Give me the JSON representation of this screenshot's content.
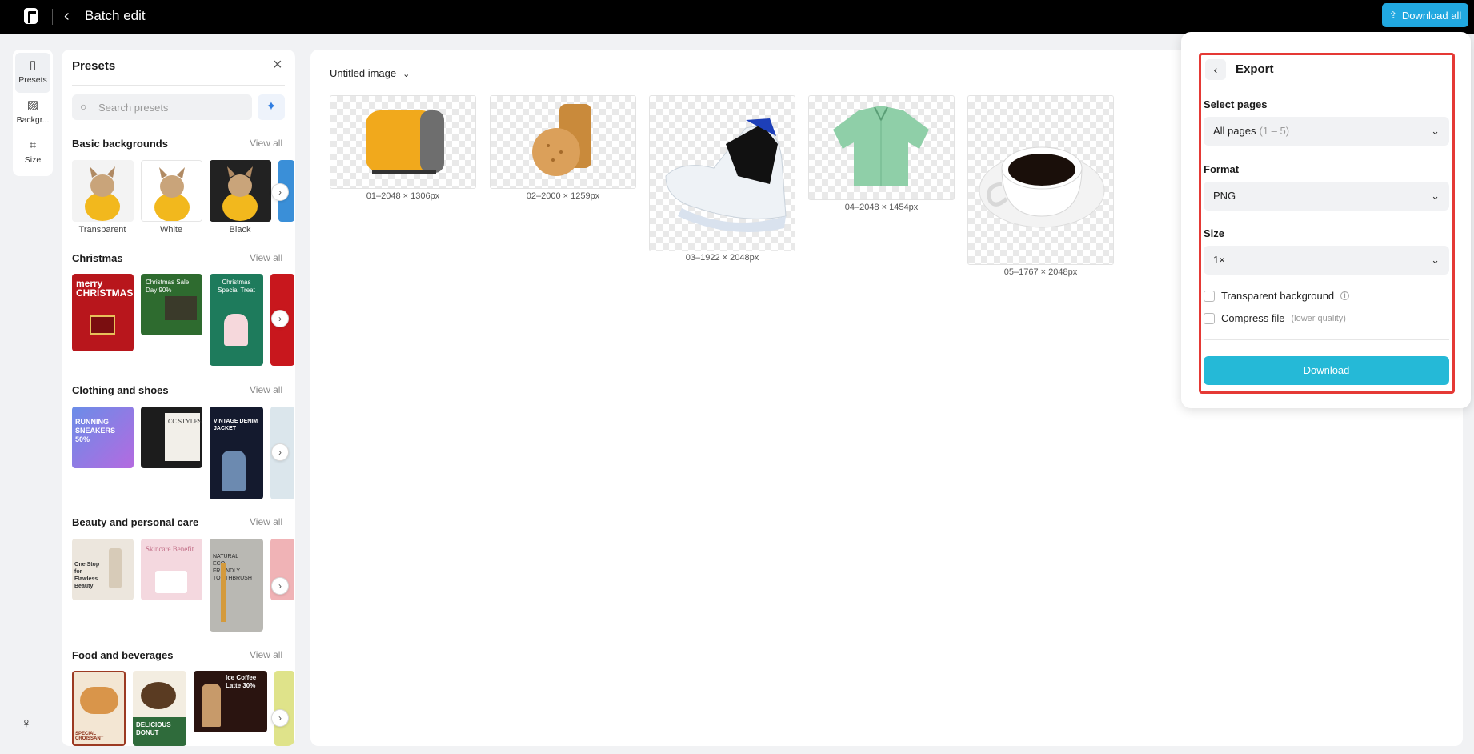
{
  "header": {
    "title": "Batch edit",
    "download_all": "Download all"
  },
  "rail": {
    "items": [
      {
        "label": "Presets"
      },
      {
        "label": "Backgr..."
      },
      {
        "label": "Size"
      }
    ]
  },
  "presets": {
    "title": "Presets",
    "search_placeholder": "Search presets",
    "sections": [
      {
        "title": "Basic backgrounds",
        "view_all": "View all",
        "labels": [
          "Transparent",
          "White",
          "Black"
        ]
      },
      {
        "title": "Christmas",
        "view_all": "View all",
        "thumbs": [
          "merry CHRISTMAS",
          "Christmas Sale Day 90%",
          "Christmas Special Treat"
        ]
      },
      {
        "title": "Clothing and shoes",
        "view_all": "View all",
        "thumbs": [
          "RUNNING SNEAKERS 50%",
          "CC STYLES",
          "VINTAGE DENIM JACKET"
        ]
      },
      {
        "title": "Beauty and personal care",
        "view_all": "View all",
        "thumbs": [
          "One Stop for Flawless Beauty",
          "Skincare Benefit",
          "NATURAL ECO FRIENDLY TOOTHBRUSH"
        ]
      },
      {
        "title": "Food and beverages",
        "view_all": "View all",
        "thumbs": [
          "SPECIAL CROISSANT",
          "DELICIOUS DONUT",
          "Ice Coffee Latte 30%"
        ]
      }
    ]
  },
  "canvas": {
    "doc_title": "Untitled image",
    "images": [
      {
        "caption": "01–2048 × 1306px",
        "subject": "toaster"
      },
      {
        "caption": "02–2000 × 1259px",
        "subject": "cookies"
      },
      {
        "caption": "03–1922 × 2048px",
        "subject": "sneaker"
      },
      {
        "caption": "04–2048 × 1454px",
        "subject": "shirt"
      },
      {
        "caption": "05–1767 × 2048px",
        "subject": "coffee-cup"
      }
    ]
  },
  "export": {
    "title": "Export",
    "select_pages_label": "Select pages",
    "pages_value": "All pages",
    "pages_range": "(1 – 5)",
    "format_label": "Format",
    "format_value": "PNG",
    "size_label": "Size",
    "size_value": "1×",
    "transparent_label": "Transparent background",
    "compress_label": "Compress file",
    "compress_hint": "(lower quality)",
    "download": "Download"
  },
  "colors": {
    "accent": "#25b9d7",
    "highlight_border": "#e53935"
  }
}
